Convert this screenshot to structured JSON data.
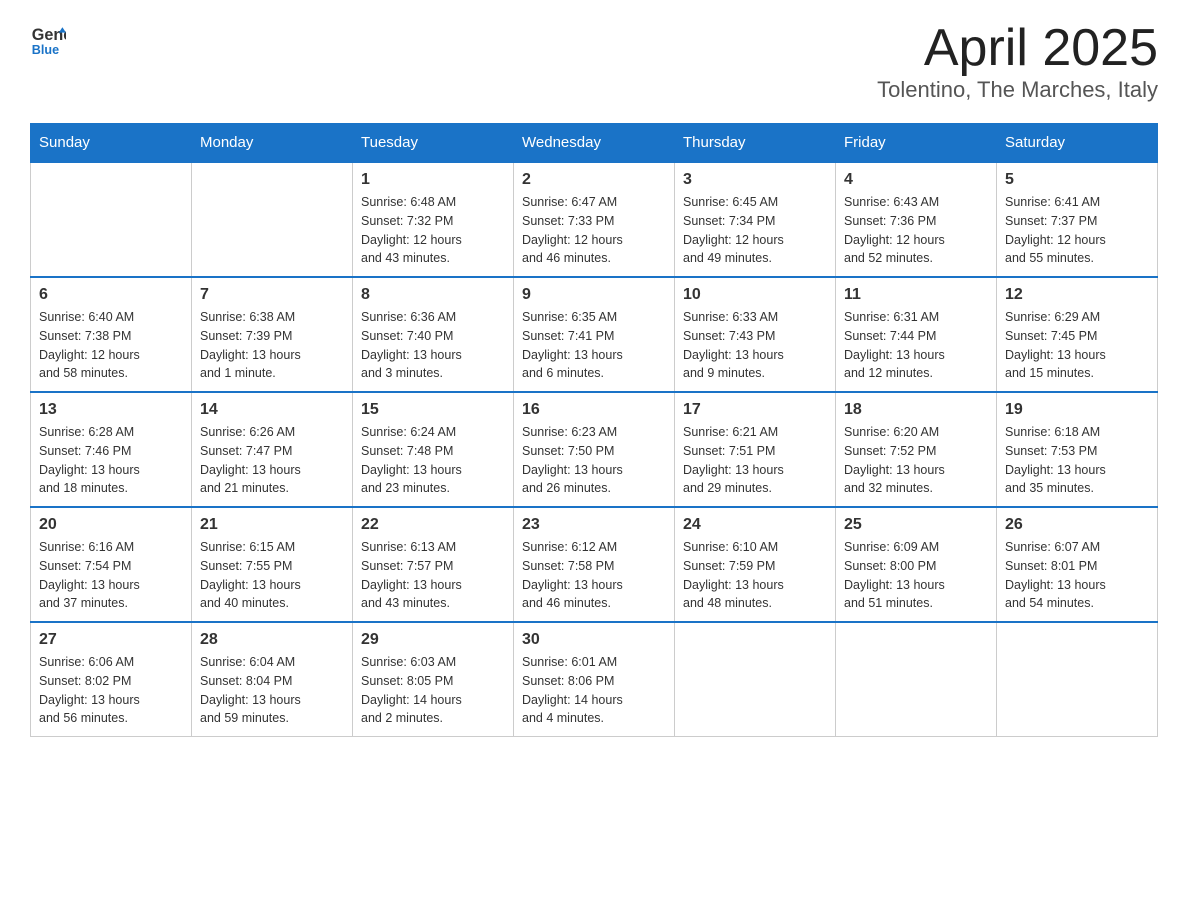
{
  "header": {
    "logo_text_general": "General",
    "logo_text_blue": "Blue",
    "title": "April 2025",
    "subtitle": "Tolentino, The Marches, Italy"
  },
  "days_of_week": [
    "Sunday",
    "Monday",
    "Tuesday",
    "Wednesday",
    "Thursday",
    "Friday",
    "Saturday"
  ],
  "weeks": [
    [
      {
        "day": "",
        "info": ""
      },
      {
        "day": "",
        "info": ""
      },
      {
        "day": "1",
        "info": "Sunrise: 6:48 AM\nSunset: 7:32 PM\nDaylight: 12 hours\nand 43 minutes."
      },
      {
        "day": "2",
        "info": "Sunrise: 6:47 AM\nSunset: 7:33 PM\nDaylight: 12 hours\nand 46 minutes."
      },
      {
        "day": "3",
        "info": "Sunrise: 6:45 AM\nSunset: 7:34 PM\nDaylight: 12 hours\nand 49 minutes."
      },
      {
        "day": "4",
        "info": "Sunrise: 6:43 AM\nSunset: 7:36 PM\nDaylight: 12 hours\nand 52 minutes."
      },
      {
        "day": "5",
        "info": "Sunrise: 6:41 AM\nSunset: 7:37 PM\nDaylight: 12 hours\nand 55 minutes."
      }
    ],
    [
      {
        "day": "6",
        "info": "Sunrise: 6:40 AM\nSunset: 7:38 PM\nDaylight: 12 hours\nand 58 minutes."
      },
      {
        "day": "7",
        "info": "Sunrise: 6:38 AM\nSunset: 7:39 PM\nDaylight: 13 hours\nand 1 minute."
      },
      {
        "day": "8",
        "info": "Sunrise: 6:36 AM\nSunset: 7:40 PM\nDaylight: 13 hours\nand 3 minutes."
      },
      {
        "day": "9",
        "info": "Sunrise: 6:35 AM\nSunset: 7:41 PM\nDaylight: 13 hours\nand 6 minutes."
      },
      {
        "day": "10",
        "info": "Sunrise: 6:33 AM\nSunset: 7:43 PM\nDaylight: 13 hours\nand 9 minutes."
      },
      {
        "day": "11",
        "info": "Sunrise: 6:31 AM\nSunset: 7:44 PM\nDaylight: 13 hours\nand 12 minutes."
      },
      {
        "day": "12",
        "info": "Sunrise: 6:29 AM\nSunset: 7:45 PM\nDaylight: 13 hours\nand 15 minutes."
      }
    ],
    [
      {
        "day": "13",
        "info": "Sunrise: 6:28 AM\nSunset: 7:46 PM\nDaylight: 13 hours\nand 18 minutes."
      },
      {
        "day": "14",
        "info": "Sunrise: 6:26 AM\nSunset: 7:47 PM\nDaylight: 13 hours\nand 21 minutes."
      },
      {
        "day": "15",
        "info": "Sunrise: 6:24 AM\nSunset: 7:48 PM\nDaylight: 13 hours\nand 23 minutes."
      },
      {
        "day": "16",
        "info": "Sunrise: 6:23 AM\nSunset: 7:50 PM\nDaylight: 13 hours\nand 26 minutes."
      },
      {
        "day": "17",
        "info": "Sunrise: 6:21 AM\nSunset: 7:51 PM\nDaylight: 13 hours\nand 29 minutes."
      },
      {
        "day": "18",
        "info": "Sunrise: 6:20 AM\nSunset: 7:52 PM\nDaylight: 13 hours\nand 32 minutes."
      },
      {
        "day": "19",
        "info": "Sunrise: 6:18 AM\nSunset: 7:53 PM\nDaylight: 13 hours\nand 35 minutes."
      }
    ],
    [
      {
        "day": "20",
        "info": "Sunrise: 6:16 AM\nSunset: 7:54 PM\nDaylight: 13 hours\nand 37 minutes."
      },
      {
        "day": "21",
        "info": "Sunrise: 6:15 AM\nSunset: 7:55 PM\nDaylight: 13 hours\nand 40 minutes."
      },
      {
        "day": "22",
        "info": "Sunrise: 6:13 AM\nSunset: 7:57 PM\nDaylight: 13 hours\nand 43 minutes."
      },
      {
        "day": "23",
        "info": "Sunrise: 6:12 AM\nSunset: 7:58 PM\nDaylight: 13 hours\nand 46 minutes."
      },
      {
        "day": "24",
        "info": "Sunrise: 6:10 AM\nSunset: 7:59 PM\nDaylight: 13 hours\nand 48 minutes."
      },
      {
        "day": "25",
        "info": "Sunrise: 6:09 AM\nSunset: 8:00 PM\nDaylight: 13 hours\nand 51 minutes."
      },
      {
        "day": "26",
        "info": "Sunrise: 6:07 AM\nSunset: 8:01 PM\nDaylight: 13 hours\nand 54 minutes."
      }
    ],
    [
      {
        "day": "27",
        "info": "Sunrise: 6:06 AM\nSunset: 8:02 PM\nDaylight: 13 hours\nand 56 minutes."
      },
      {
        "day": "28",
        "info": "Sunrise: 6:04 AM\nSunset: 8:04 PM\nDaylight: 13 hours\nand 59 minutes."
      },
      {
        "day": "29",
        "info": "Sunrise: 6:03 AM\nSunset: 8:05 PM\nDaylight: 14 hours\nand 2 minutes."
      },
      {
        "day": "30",
        "info": "Sunrise: 6:01 AM\nSunset: 8:06 PM\nDaylight: 14 hours\nand 4 minutes."
      },
      {
        "day": "",
        "info": ""
      },
      {
        "day": "",
        "info": ""
      },
      {
        "day": "",
        "info": ""
      }
    ]
  ]
}
